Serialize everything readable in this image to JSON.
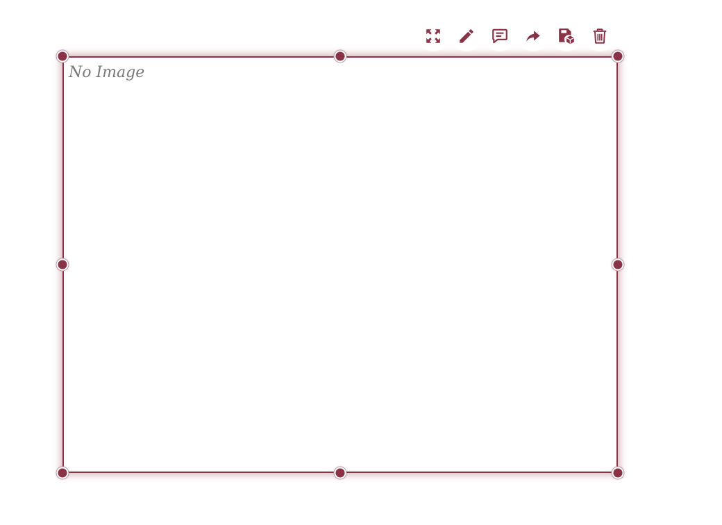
{
  "canvas": {
    "placeholder_text": "No Image"
  },
  "toolbar": {
    "buttons": [
      {
        "icon": "fullscreen-icon"
      },
      {
        "icon": "pencil-icon"
      },
      {
        "icon": "comment-icon"
      },
      {
        "icon": "share-arrow-icon"
      },
      {
        "icon": "save-stack-icon"
      },
      {
        "icon": "trash-icon"
      }
    ]
  },
  "colors": {
    "accent": "#8a3347",
    "placeholder_text": "#7a7a7a",
    "background": "#ffffff"
  }
}
